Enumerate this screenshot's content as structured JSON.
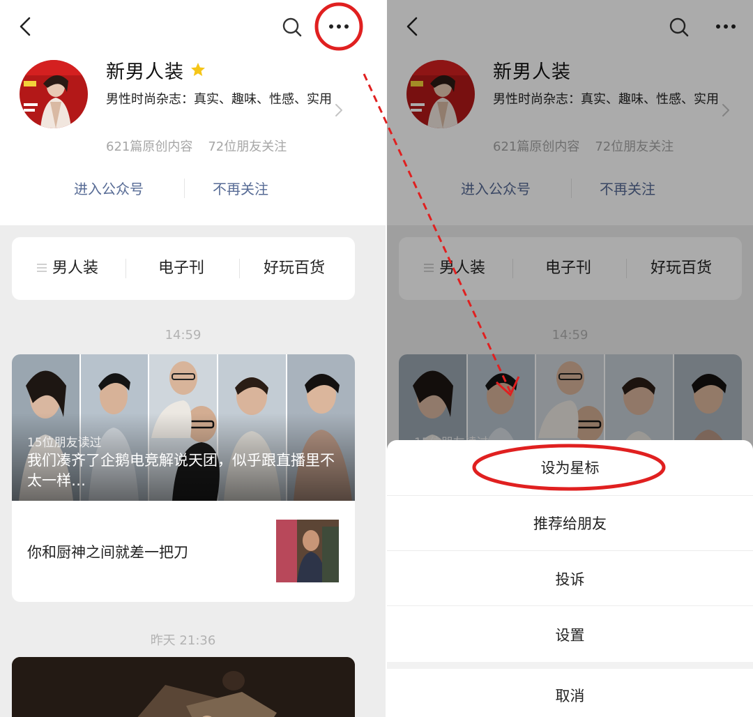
{
  "account": {
    "name": "新男人装",
    "description": "男性时尚杂志：真实、趣味、性感、实用",
    "original_count": "621篇原创内容",
    "friends_following": "72位朋友关注"
  },
  "actions": {
    "enter": "进入公众号",
    "unfollow": "不再关注"
  },
  "tabs": [
    "男人装",
    "电子刊",
    "好玩百货"
  ],
  "feed": {
    "time1": "14:59",
    "main_article": {
      "readers": "15位朋友读过",
      "title": "我们凑齐了企鹅电竞解说天团，似乎跟直播里不太一样…"
    },
    "sub_article": {
      "title": "你和厨神之间就差一把刀"
    },
    "time2": "昨天 21:36"
  },
  "sheet": {
    "items": [
      "设为星标",
      "推荐给朋友",
      "投诉",
      "设置"
    ],
    "cancel": "取消"
  },
  "icons": [
    "back-icon",
    "search-icon",
    "more-icon",
    "star-icon",
    "chevron-right-icon",
    "menu-lines-icon"
  ],
  "colors": {
    "link": "#576b95",
    "star": "#f5c518",
    "annotation": "#e02020"
  }
}
